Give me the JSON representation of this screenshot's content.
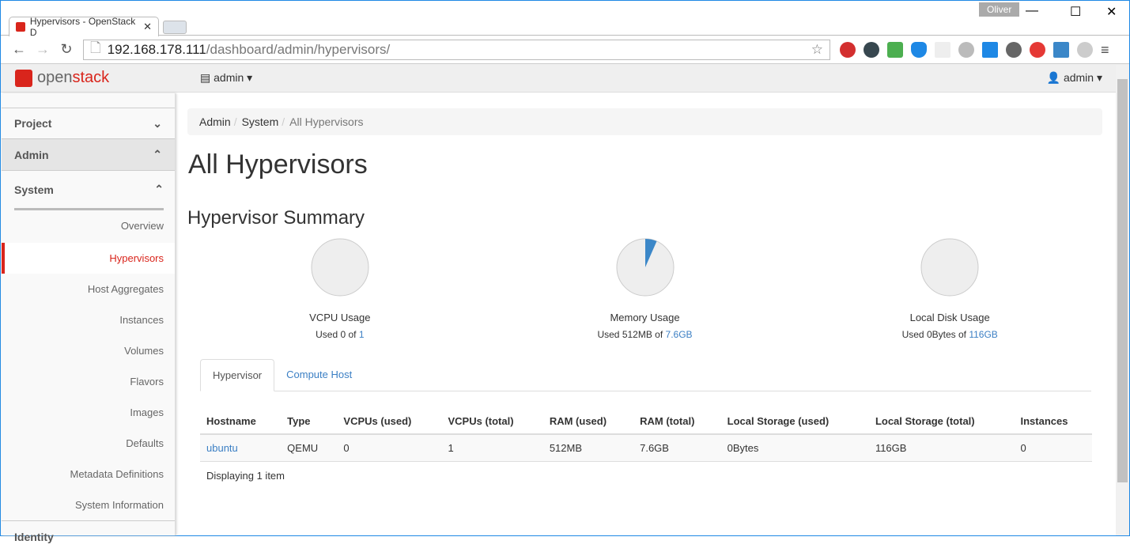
{
  "browser": {
    "tab_title": "Hypervisors - OpenStack D",
    "profile": "Oliver",
    "url_host": "192.168.178.111",
    "url_path": "/dashboard/admin/hypervisors/"
  },
  "topnav": {
    "logo_open": "open",
    "logo_stack": "stack",
    "project": "admin",
    "user": "admin"
  },
  "sidebar": {
    "project": "Project",
    "admin": "Admin",
    "system": "System",
    "items": [
      "Overview",
      "Hypervisors",
      "Host Aggregates",
      "Instances",
      "Volumes",
      "Flavors",
      "Images",
      "Defaults",
      "Metadata Definitions",
      "System Information"
    ],
    "active": "Hypervisors",
    "identity": "Identity"
  },
  "breadcrumb": [
    "Admin",
    "System",
    "All Hypervisors"
  ],
  "page_title": "All Hypervisors",
  "summary_title": "Hypervisor Summary",
  "pies": [
    {
      "title": "VCPU Usage",
      "prefix": "Used ",
      "used": "0",
      "of": " of ",
      "total": "1",
      "fraction": 0
    },
    {
      "title": "Memory Usage",
      "prefix": "Used ",
      "used": "512MB",
      "of": " of ",
      "total": "7.6GB",
      "fraction": 0.066
    },
    {
      "title": "Local Disk Usage",
      "prefix": "Used ",
      "used": "0Bytes",
      "of": " of ",
      "total": "116GB",
      "fraction": 0
    }
  ],
  "pie_colors": {
    "used": "#3b87c8",
    "free": "#eeeeee"
  },
  "tabs": [
    "Hypervisor",
    "Compute Host"
  ],
  "table": {
    "headers": [
      "Hostname",
      "Type",
      "VCPUs (used)",
      "VCPUs (total)",
      "RAM (used)",
      "RAM (total)",
      "Local Storage (used)",
      "Local Storage (total)",
      "Instances"
    ],
    "rows": [
      [
        "ubuntu",
        "QEMU",
        "0",
        "1",
        "512MB",
        "7.6GB",
        "0Bytes",
        "116GB",
        "0"
      ]
    ]
  },
  "footer": "Displaying 1 item"
}
